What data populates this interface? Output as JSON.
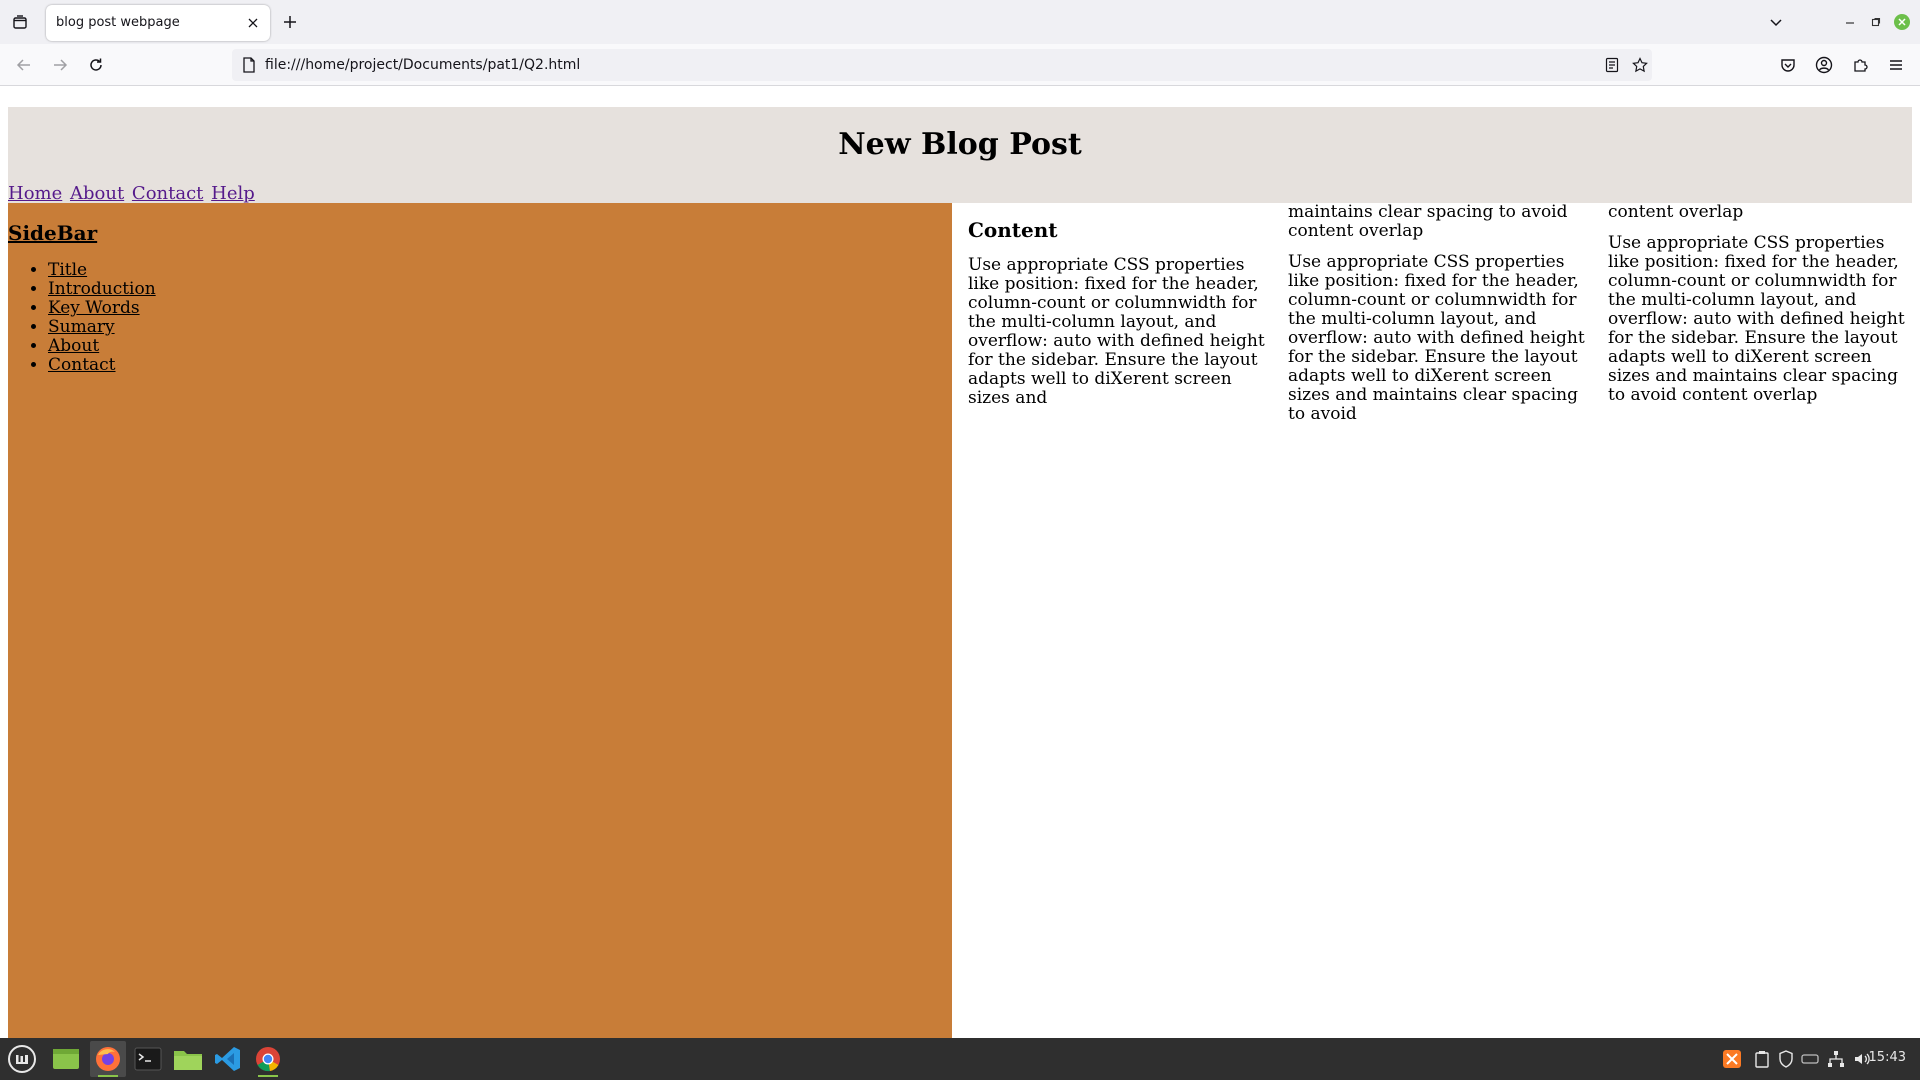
{
  "browser": {
    "tab": {
      "title": "blog post webpage"
    },
    "url": "file:///home/project/Documents/pat1/Q2.html",
    "icons": {
      "tab_list": "tab-list-icon",
      "close_tab": "close-icon",
      "new_tab": "plus-icon",
      "tabs_overflow": "chevron-down-icon",
      "back": "back-arrow-icon",
      "forward": "forward-arrow-icon",
      "reload": "reload-icon",
      "page": "page-icon",
      "reader": "reader-view-icon",
      "bookmark": "star-icon",
      "pocket": "pocket-icon",
      "account": "account-icon",
      "extensions": "puzzle-icon",
      "menu": "hamburger-menu-icon"
    }
  },
  "page": {
    "header": {
      "title": "New Blog Post",
      "nav": [
        {
          "label": "Home"
        },
        {
          "label": "About"
        },
        {
          "label": "Contact"
        },
        {
          "label": "Help"
        }
      ]
    },
    "sidebar": {
      "title": "SideBar",
      "items": [
        {
          "label": "Title"
        },
        {
          "label": "Introduction"
        },
        {
          "label": "Key Words"
        },
        {
          "label": "Sumary"
        },
        {
          "label": "About"
        },
        {
          "label": "Contact"
        }
      ]
    },
    "content": {
      "title": "Content",
      "col1": "Use appropriate CSS properties like position: fixed for the header, column-count or columnwidth for the multi-column layout, and overflow: auto with defined height for the sidebar. Ensure the layout adapts well to diXerent screen sizes and",
      "col2_top": "maintains clear spacing to avoid content overlap",
      "col2_para": "Use appropriate CSS properties like position: fixed for the header, column-count or columnwidth for the multi-column layout, and overflow: auto with defined height for the sidebar. Ensure the layout adapts well to diXerent screen sizes and maintains clear spacing to avoid",
      "col3_top": "content overlap",
      "col3_para": "Use appropriate CSS properties like position: fixed for the header, column-count or columnwidth for the multi-column layout, and overflow: auto with defined height for the sidebar. Ensure the layout adapts well to diXerent screen sizes and maintains clear spacing to avoid content overlap"
    }
  },
  "colors": {
    "header_bg": "#e6e1dd",
    "sidebar_bg": "#c87d38",
    "visited_link": "#551a8b"
  },
  "taskbar": {
    "apps": [
      "mint-menu-icon",
      "desktop-icon",
      "firefox-icon",
      "terminal-icon",
      "files-icon",
      "vscode-icon",
      "chrome-icon"
    ],
    "tray": [
      "xampp-icon",
      "clipboard-icon",
      "shield-icon",
      "network-card-icon",
      "network-icon",
      "volume-icon"
    ],
    "clock": "15:43"
  }
}
